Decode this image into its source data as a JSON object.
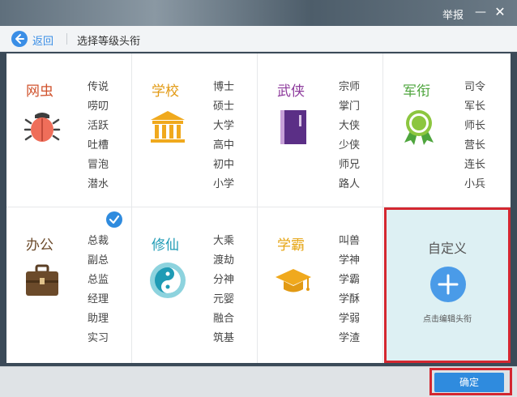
{
  "window": {
    "report_label": "举报",
    "minimize_glyph": "—",
    "close_glyph": "✕"
  },
  "header": {
    "back_label": "返回",
    "title": "选择等级头衔"
  },
  "categories": [
    {
      "name": "网虫",
      "color": "#d0532e",
      "icon": "bug-icon",
      "titles": [
        "传说",
        "唠叨",
        "活跃",
        "吐槽",
        "冒泡",
        "潜水"
      ]
    },
    {
      "name": "学校",
      "color": "#e29a14",
      "icon": "school-building-icon",
      "titles": [
        "博士",
        "硕士",
        "大学",
        "高中",
        "初中",
        "小学"
      ]
    },
    {
      "name": "武侠",
      "color": "#8d3a9c",
      "icon": "martial-book-icon",
      "titles": [
        "宗师",
        "掌门",
        "大侠",
        "少侠",
        "师兄",
        "路人"
      ]
    },
    {
      "name": "军衔",
      "color": "#4ea53d",
      "icon": "medal-icon",
      "titles": [
        "司令",
        "军长",
        "师长",
        "营长",
        "连长",
        "小兵"
      ]
    },
    {
      "name": "办公",
      "color": "#6b4a2a",
      "icon": "briefcase-icon",
      "titles": [
        "总裁",
        "副总",
        "总监",
        "经理",
        "助理",
        "实习"
      ],
      "selected": true
    },
    {
      "name": "修仙",
      "color": "#1f9bb5",
      "icon": "yin-yang-icon",
      "titles": [
        "大乘",
        "渡劫",
        "分神",
        "元婴",
        "融合",
        "筑基"
      ]
    },
    {
      "name": "学霸",
      "color": "#e6a412",
      "icon": "graduation-cap-icon",
      "titles": [
        "叫兽",
        "学神",
        "学霸",
        "学酥",
        "学弱",
        "学渣"
      ]
    }
  ],
  "custom": {
    "title": "自定义",
    "hint": "点击编辑头衔"
  },
  "footer": {
    "confirm_label": "确定"
  }
}
